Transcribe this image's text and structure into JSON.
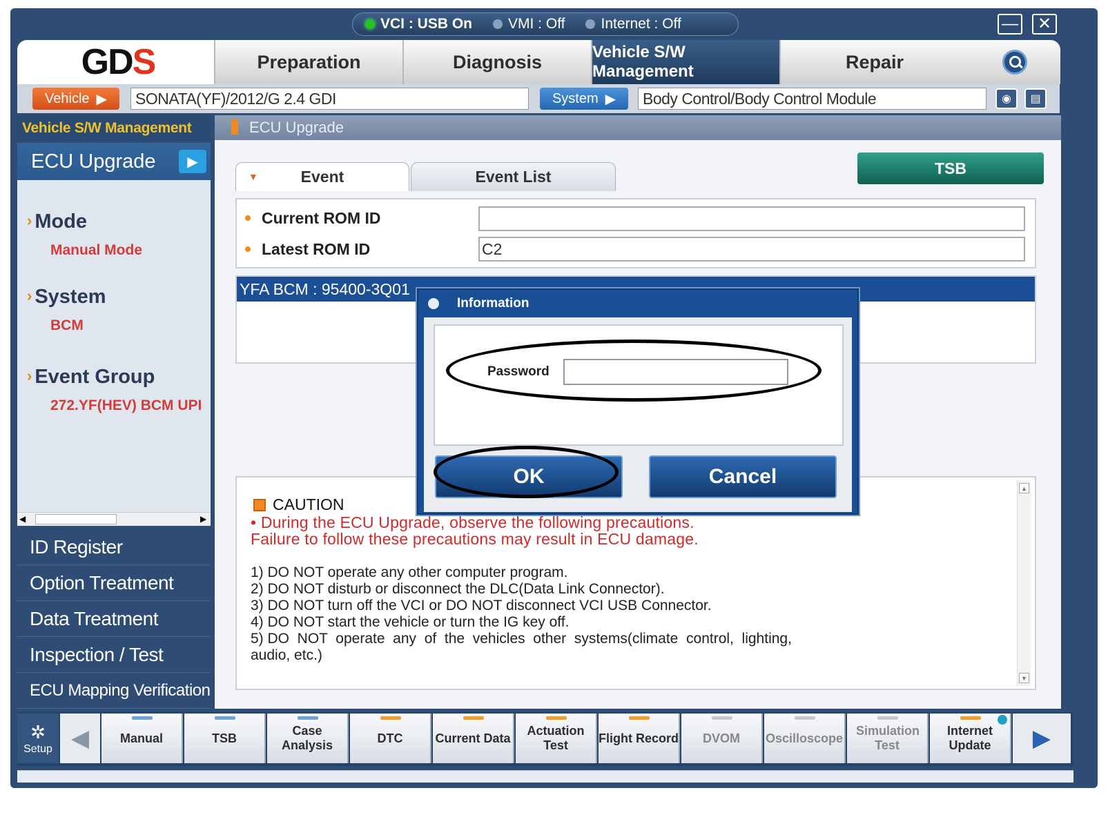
{
  "status": {
    "vci": "VCI : USB On",
    "vmi": "VMI : Off",
    "internet": "Internet : Off",
    "vci_color": "#22c41e",
    "off_color": "#8aa0bd"
  },
  "window": {
    "minimize": "—",
    "close": "✕"
  },
  "logo": {
    "part1": "GD",
    "part2": "S"
  },
  "tabs": [
    {
      "label": "Preparation"
    },
    {
      "label": "Diagnosis"
    },
    {
      "label": "Vehicle S/W Management"
    },
    {
      "label": "Repair"
    }
  ],
  "vehicle_bar": {
    "vehicle_label": "Vehicle",
    "vehicle_value": "SONATA(YF)/2012/G 2.4 GDI",
    "system_label": "System",
    "system_value": "Body Control/Body Control Module",
    "vehicle_color": "#e5601d",
    "system_color": "#2f79c6"
  },
  "sidebar": {
    "header": "Vehicle S/W Management",
    "current": "ECU Upgrade",
    "groups": [
      {
        "heading": "Mode",
        "value": "Manual Mode"
      },
      {
        "heading": "System",
        "value": "BCM"
      },
      {
        "heading": "Event Group",
        "value": "272.YF(HEV) BCM UPI"
      }
    ],
    "links": [
      "ID Register",
      "Option Treatment",
      "Data Treatment",
      "Inspection / Test",
      "ECU Mapping Verification"
    ]
  },
  "content": {
    "header": "ECU Upgrade",
    "tab_event": "Event",
    "tab_event_list": "Event List",
    "tsb": "TSB",
    "current_rom_label": "Current ROM ID",
    "current_rom_value": "",
    "latest_rom_label": "Latest ROM ID",
    "latest_rom_value": "C2",
    "ecu_row": "YFA BCM : 95400-3Q01"
  },
  "caution": {
    "title": "CAUTION",
    "warn1": "• During the ECU Upgrade, observe the following precautions.",
    "warn2": "Failure to follow these precautions may result in ECU damage.",
    "steps": [
      "1) DO NOT operate any other computer program.",
      "2) DO NOT disturb or disconnect the DLC(Data Link Connector).",
      "3) DO NOT turn off the VCI or DO NOT disconnect VCI USB Connector.",
      "4) DO NOT start the vehicle or turn the IG key off.",
      "5) DO  NOT  operate  any  of  the  vehicles  other  systems(climate  control,  lighting,",
      "audio, etc.)"
    ]
  },
  "dialog": {
    "title": "Information",
    "password_label": "Password",
    "password_value": "",
    "ok": "OK",
    "cancel": "Cancel"
  },
  "toolbar": {
    "setup": "Setup",
    "buttons": [
      {
        "label": "Manual",
        "bar": "#6fa1d6"
      },
      {
        "label": "TSB",
        "bar": "#6fa1d6"
      },
      {
        "label": "Case Analysis",
        "bar": "#6fa1d6"
      },
      {
        "label": "DTC",
        "bar": "#f0a02a"
      },
      {
        "label": "Current Data",
        "bar": "#f0a02a"
      },
      {
        "label": "Actuation Test",
        "bar": "#f0a02a"
      },
      {
        "label": "Flight Record",
        "bar": "#f0a02a"
      },
      {
        "label": "DVOM",
        "bar": "#c9c9c9"
      },
      {
        "label": "Oscilloscope",
        "bar": "#c9c9c9"
      },
      {
        "label": "Simulation Test",
        "bar": "#c9c9c9"
      },
      {
        "label": "Internet Update",
        "bar": "#f0a02a"
      }
    ]
  }
}
